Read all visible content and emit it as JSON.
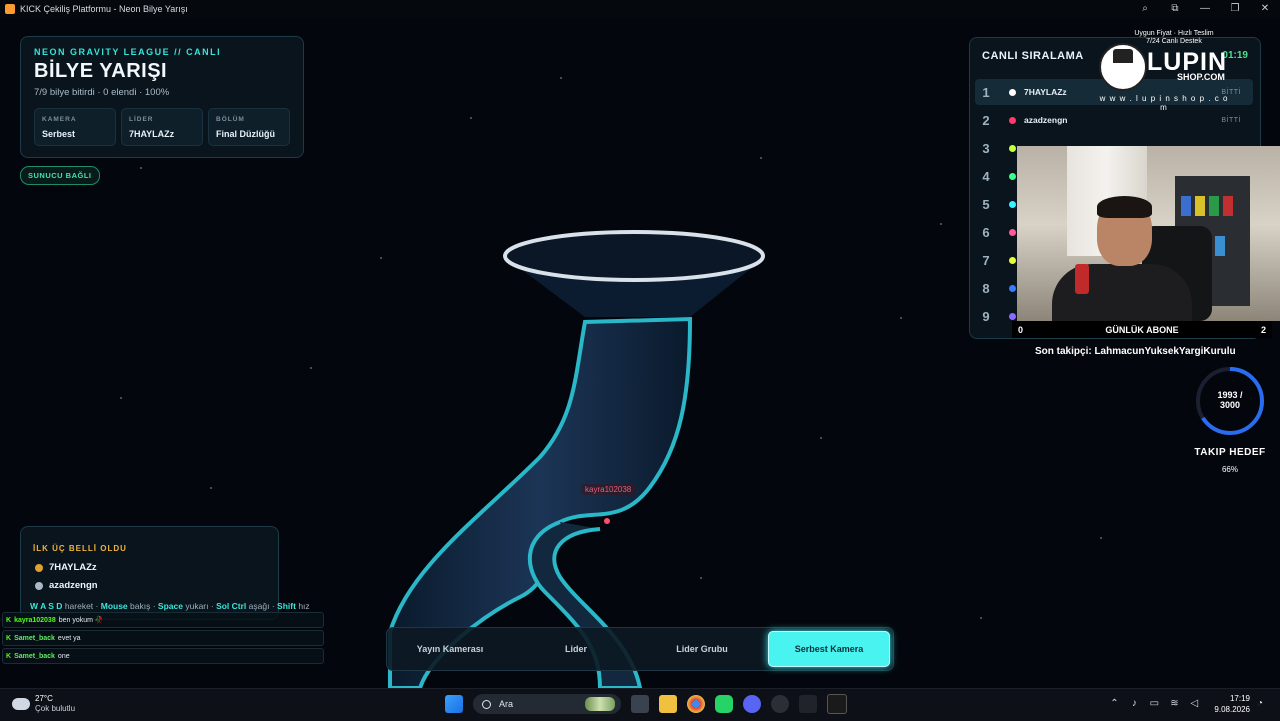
{
  "window": {
    "title": "KICK Çekiliş Platformu - Neon Bilye Yarışı",
    "controls": [
      "search-icon",
      "extension-icon",
      "minimize-icon",
      "restore-icon",
      "close-icon"
    ]
  },
  "info": {
    "league": "NEON GRAVITY LEAGUE // CANLI",
    "title": "BİLYE YARIŞI",
    "subtitle": "7/9 bilye bitirdi · 0 elendi · 100%",
    "stats": [
      {
        "label": "KAMERA",
        "value": "Serbest"
      },
      {
        "label": "LİDER",
        "value": "7HAYLAZz"
      },
      {
        "label": "BÖLÜM",
        "value": "Final Düzlüğü"
      }
    ]
  },
  "server_status": "SUNUCU BAĞLI",
  "ranking": {
    "title": "CANLI SIRALAMA",
    "timer": "01:19",
    "rows": [
      {
        "rank": "1",
        "name": "7HAYLAZz",
        "status": "BİTTİ",
        "color": "#ffffff"
      },
      {
        "rank": "2",
        "name": "azadzengn",
        "status": "BİTTİ",
        "color": "#ff3b6b"
      },
      {
        "rank": "3",
        "name": "",
        "status": "",
        "color": "#c6ff3b"
      },
      {
        "rank": "4",
        "name": "",
        "status": "",
        "color": "#3bff8c"
      },
      {
        "rank": "5",
        "name": "",
        "status": "",
        "color": "#3bf0ff"
      },
      {
        "rank": "6",
        "name": "",
        "status": "",
        "color": "#ff5a9a"
      },
      {
        "rank": "7",
        "name": "",
        "status": "",
        "color": "#e7ff3b"
      },
      {
        "rank": "8",
        "name": "",
        "status": "",
        "color": "#3b7bff"
      },
      {
        "rank": "9",
        "name": "",
        "status": "",
        "color": "#8a6bff"
      }
    ]
  },
  "sponsor": {
    "tagline1": "Uygun Fiyat · Hızlı Teslim",
    "tagline2": "7/24 Canlı Destek",
    "brand": "LUPIN",
    "brand_sub": "SHOP.COM",
    "site": "w w w . l u p i n s h o p . c o m"
  },
  "subs": {
    "left": "0",
    "label": "GÜNLÜK ABONE",
    "right": "2"
  },
  "follower": "Son takipçi: LahmacunYuksekYargiKurulu",
  "goal": {
    "current": "1993 /",
    "target": "3000",
    "label": "TAKIP HEDEF",
    "percent": "66%",
    "progress": 0.66
  },
  "marble_label": "kayra102038",
  "top3": {
    "title": "İLK ÜÇ BELLİ OLDU",
    "entries": [
      {
        "name": "7HAYLAZz",
        "medal_color": "#e0a030"
      },
      {
        "name": "azadzengn",
        "medal_color": "#aab8c8"
      }
    ]
  },
  "controls_hint": {
    "k1": "W A S D",
    "t1": "hareket ·",
    "k2": "Mouse",
    "t2": "bakış ·",
    "k3": "Space",
    "t3": "yukarı ·",
    "k4": "Sol Ctrl",
    "t4": "aşağı ·",
    "k5": "Shift",
    "t5": "hız"
  },
  "chat": [
    {
      "user": "kayra102038",
      "message": "ben yokum 🥀"
    },
    {
      "user": "Samet_back",
      "message": "evet ya"
    },
    {
      "user": "Samet_back",
      "message": "one"
    }
  ],
  "camera_buttons": [
    {
      "label": "Yayın Kamerası",
      "active": false
    },
    {
      "label": "Lider",
      "active": false
    },
    {
      "label": "Lider Grubu",
      "active": false
    },
    {
      "label": "Serbest Kamera",
      "active": true
    }
  ],
  "taskbar": {
    "weather_temp": "27°C",
    "weather_desc": "Çok bulutlu",
    "search_placeholder": "Ara",
    "time": "17:19",
    "date": "9.08.2026"
  }
}
